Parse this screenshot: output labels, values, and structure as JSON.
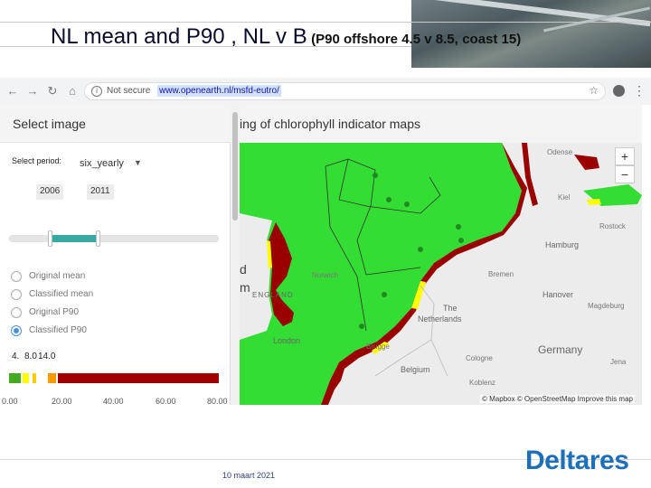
{
  "slide": {
    "title_main": "NL mean and P90 , NL v B",
    "title_sub_dark": "(P90 offshore 4.5 v 8.5,",
    "title_sub_light": "coast 15)",
    "footer_date": "10 maart 2021",
    "logo_text": "Deltares"
  },
  "browser": {
    "not_secure": "Not secure",
    "url": "www.openearth.nl/msfd-eutro/",
    "icons": [
      "back-icon",
      "forward-icon",
      "reload-icon",
      "home-icon",
      "info-icon",
      "star-icon",
      "profile-icon",
      "menu-icon"
    ]
  },
  "panel": {
    "title": "Select image",
    "period_label": "Select period:",
    "period_value": "six_yearly",
    "year_start": "2006",
    "year_end": "2011",
    "options": [
      "Original mean",
      "Classified mean",
      "Original P90",
      "Classified P90"
    ],
    "selected_option": "Classified P90",
    "thresholds": [
      "4.",
      "8.0",
      "14.0"
    ],
    "legend_colors": [
      "#44aa22",
      "#ffff00",
      "#ff9900",
      "#a00000"
    ],
    "axis_ticks": [
      "0.00",
      "20.00",
      "40.00",
      "60.00",
      "80.00"
    ]
  },
  "map": {
    "title": "ing of chlorophyll indicator maps",
    "zoom_in": "+",
    "zoom_out": "−",
    "attribution": "© Mapbox © OpenStreetMap  Improve this map",
    "labels": {
      "hamburg": "Hamburg",
      "hanover": "Hanover",
      "magdeburg": "Magdeburg",
      "germany": "Germany",
      "the": "The",
      "netherlands": "Netherlands",
      "england": "ENGLAND",
      "london": "London",
      "belgium": "Belgium",
      "norwich": "Norwich",
      "cologne": "Cologne",
      "koblenz": "Koblenz",
      "rostock": "Rostock",
      "kiel": "Kiel",
      "bremen": "Bremen",
      "brugge": "Brugge",
      "odense": "Odense",
      "jena": "Jena",
      "d_fragment": "d",
      "m_fragment": "m"
    },
    "colors": {
      "sea_good": "#33dd33",
      "coast_bad": "#990000",
      "coast_mid": "#ffff00",
      "land": "#ececec"
    }
  }
}
